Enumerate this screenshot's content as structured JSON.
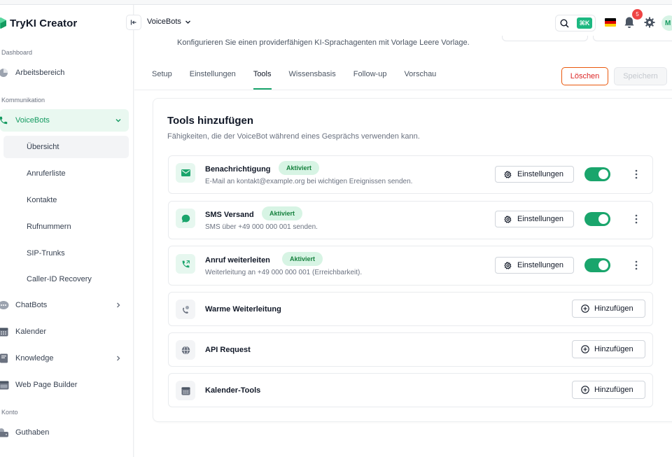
{
  "app": {
    "name": "TryKI Creator"
  },
  "sidebar": {
    "sections": {
      "dashboard": "Dashboard",
      "kommunikation": "Kommunikation",
      "konto": "Konto"
    },
    "items": {
      "arbeitsbereich": "Arbeitsbereich",
      "voicebots": "VoiceBots",
      "chatbots": "ChatBots",
      "kalender": "Kalender",
      "knowledge": "Knowledge",
      "webpage": "Web Page Builder",
      "guthaben": "Guthaben"
    },
    "voicebots_sub": [
      "Übersicht",
      "Anruferliste",
      "Kontakte",
      "Rufnummern",
      "SIP-Trunks",
      "Caller-ID Recovery"
    ]
  },
  "header": {
    "project": "VoiceBots",
    "shortcut": "⌘K",
    "notification_count": "5",
    "avatar_initial": "M"
  },
  "page": {
    "description": "Konfigurieren Sie einen providerfähigen KI-Sprachagenten mit Vorlage Leere Vorlage.",
    "tabs": [
      "Setup",
      "Einstellungen",
      "Tools",
      "Wissensbasis",
      "Follow-up",
      "Vorschau"
    ],
    "active_tab": "Tools",
    "delete_label": "Löschen",
    "save_label": "Speichern"
  },
  "tools": {
    "title": "Tools hinzufügen",
    "subtitle": "Fähigkeiten, die der VoiceBot während eines Gesprächs verwenden kann.",
    "active": [
      {
        "name": "Benachrichtigung",
        "badge": "Aktiviert",
        "description": "E-Mail an kontakt@example.org bei wichtigen Ereignissen senden.",
        "settings_label": "Einstellungen",
        "enabled": true,
        "icon": "mail-icon"
      },
      {
        "name": "SMS Versand",
        "badge": "Aktiviert",
        "description": "SMS über +49 000 000 001 senden.",
        "settings_label": "Einstellungen",
        "enabled": true,
        "icon": "chat-bubble-icon"
      },
      {
        "name": "Anruf weiterleiten",
        "badge": "Aktiviert",
        "description": "Weiterleitung an +49 000 000 001 (Erreichbarkeit).",
        "settings_label": "Einstellungen",
        "enabled": true,
        "icon": "phone-forward-icon"
      }
    ],
    "available": [
      {
        "name": "Warme Weiterleitung",
        "add_label": "Hinzufügen",
        "icon": "warm-transfer-icon"
      },
      {
        "name": "API Request",
        "add_label": "Hinzufügen",
        "icon": "globe-icon"
      },
      {
        "name": "Kalender-Tools",
        "add_label": "Hinzufügen",
        "icon": "calendar-icon"
      }
    ]
  },
  "colors": {
    "accent": "#1aa56c",
    "accent_light": "#e9f8f0",
    "danger": "#dc2626",
    "badge_bg": "#d7f4e4"
  }
}
